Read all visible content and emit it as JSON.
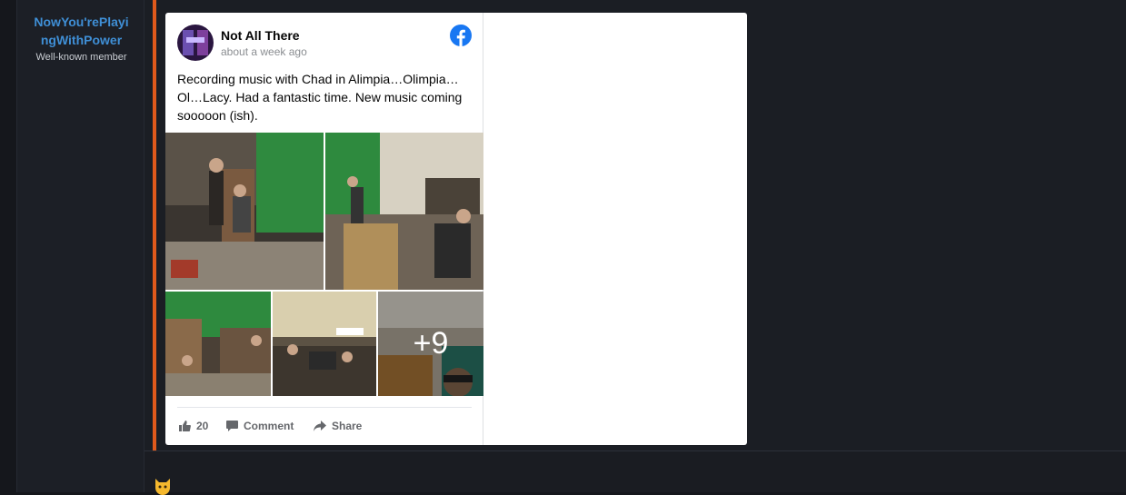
{
  "user": {
    "name": "NowYou'rePlayingWithPower",
    "name_line1": "NowYou'rePlayi",
    "name_line2": "ngWithPower",
    "title": "Well-known member"
  },
  "embed": {
    "page_name": "Not All There",
    "timestamp": "about a week ago",
    "post_text": "Recording music with Chad in Alimpia…Olimpia…Ol…Lacy. Had a fantastic time. New music coming sooooon (ish).",
    "more_photos": "+9",
    "likes": "20",
    "comment_label": "Comment",
    "share_label": "Share"
  },
  "colors": {
    "username": "#3f8fd6",
    "quote_accent": "#e05a1c",
    "facebook_blue": "#1877f2"
  },
  "icons": [
    "facebook-logo-icon",
    "like-icon",
    "comment-icon",
    "share-icon",
    "cat-emoji-icon"
  ]
}
